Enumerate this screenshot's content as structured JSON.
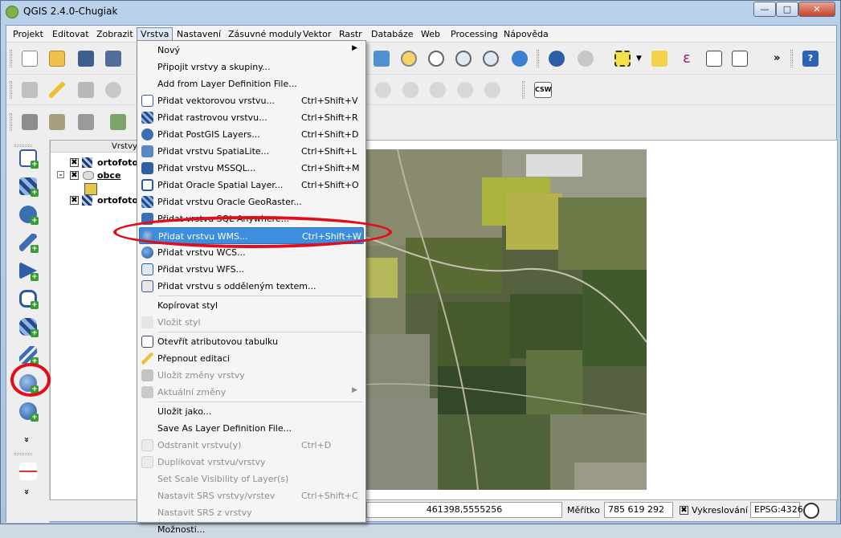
{
  "window": {
    "title": "QGIS 2.4.0-Chugiak",
    "minimize_glyph": "—",
    "maximize_glyph": "□",
    "close_glyph": "✕"
  },
  "menubar": {
    "items": [
      "Projekt",
      "Editovat",
      "Zobrazit",
      "Vrstva",
      "Nastavení",
      "Zásuvné moduly",
      "Vektor",
      "Rastr",
      "Databáze",
      "Web",
      "Processing",
      "Nápověda"
    ],
    "active": "Vrstva"
  },
  "layers_panel": {
    "title": "Vrstvy",
    "layers": [
      {
        "name": "ortofoto",
        "checked": true
      },
      {
        "name": "obce",
        "checked": true
      },
      {
        "name": "ortofoto",
        "checked": true
      }
    ]
  },
  "layer_menu": {
    "items": [
      {
        "label": "Nový",
        "shortcut": "",
        "submenu": true,
        "enabled": true,
        "icon": "none"
      },
      {
        "label": "Připojit vrstvy a skupiny...",
        "shortcut": "",
        "enabled": true,
        "icon": "none"
      },
      {
        "label": "Add from Layer Definition File...",
        "shortcut": "",
        "enabled": true,
        "icon": "none"
      },
      {
        "label": "Přidat vektorovou vrstvu...",
        "shortcut": "Ctrl+Shift+V",
        "enabled": true,
        "icon": "vector-layer-icon"
      },
      {
        "label": "Přidat rastrovou vrstvu...",
        "shortcut": "Ctrl+Shift+R",
        "enabled": true,
        "icon": "raster-layer-icon"
      },
      {
        "label": "Přidat PostGIS Layers...",
        "shortcut": "Ctrl+Shift+D",
        "enabled": true,
        "icon": "postgis-icon"
      },
      {
        "label": "Přidat vrstvu SpatiaLite...",
        "shortcut": "Ctrl+Shift+L",
        "enabled": true,
        "icon": "spatialite-icon"
      },
      {
        "label": "Přidat vrstvu MSSQL...",
        "shortcut": "Ctrl+Shift+M",
        "enabled": true,
        "icon": "mssql-icon"
      },
      {
        "label": "Přidat Oracle Spatial Layer...",
        "shortcut": "Ctrl+Shift+O",
        "enabled": true,
        "icon": "oracle-icon"
      },
      {
        "label": "Přidat vrstvu Oracle GeoRaster...",
        "shortcut": "",
        "enabled": true,
        "icon": "georaster-icon"
      },
      {
        "label": "Přidat vrstvu SQL Anywhere...",
        "shortcut": "",
        "enabled": true,
        "icon": "sqlanywhere-icon"
      },
      {
        "label": "Přidat vrstvu WMS...",
        "shortcut": "Ctrl+Shift+W",
        "enabled": true,
        "icon": "wms-icon",
        "highlighted": true
      },
      {
        "label": "Přidat vrstvu WCS...",
        "shortcut": "",
        "enabled": true,
        "icon": "wcs-icon"
      },
      {
        "label": "Přidat vrstvu WFS...",
        "shortcut": "",
        "enabled": true,
        "icon": "wfs-icon"
      },
      {
        "label": "Přidat vrstvu s odděleným textem...",
        "shortcut": "",
        "enabled": true,
        "icon": "delimited-text-icon"
      },
      {
        "label": "Kopírovat styl",
        "shortcut": "",
        "enabled": true,
        "icon": "none"
      },
      {
        "label": "Vložit styl",
        "shortcut": "",
        "enabled": false,
        "icon": "paste-style-icon"
      },
      {
        "label": "Otevřít atributovou tabulku",
        "shortcut": "",
        "enabled": true,
        "icon": "attribute-table-icon"
      },
      {
        "label": "Přepnout editaci",
        "shortcut": "",
        "enabled": true,
        "icon": "pencil-icon"
      },
      {
        "label": "Uložit změny vrstvy",
        "shortcut": "",
        "enabled": false,
        "icon": "save-edits-icon"
      },
      {
        "label": "Aktuální změny",
        "shortcut": "",
        "submenu": true,
        "enabled": false,
        "icon": "current-edits-icon"
      },
      {
        "label": "Uložit jako...",
        "shortcut": "",
        "enabled": true,
        "icon": "none"
      },
      {
        "label": "Save As Layer Definition File...",
        "shortcut": "",
        "enabled": true,
        "icon": "none"
      },
      {
        "label": "Odstranit vrstvu(y)",
        "shortcut": "Ctrl+D",
        "enabled": false,
        "icon": "remove-layer-icon"
      },
      {
        "label": "Duplikovat vrstvu/vrstvy",
        "shortcut": "",
        "enabled": false,
        "icon": "duplicate-layer-icon"
      },
      {
        "label": "Set Scale Visibility of Layer(s)",
        "shortcut": "",
        "enabled": false,
        "icon": "none"
      },
      {
        "label": "Nastavit SRS vrstvy/vrstev",
        "shortcut": "Ctrl+Shift+C",
        "enabled": false,
        "icon": "none"
      },
      {
        "label": "Nastavit SRS z vrstvy",
        "shortcut": "",
        "enabled": false,
        "icon": "none"
      },
      {
        "label": "Možnosti...",
        "shortcut": "",
        "enabled": true,
        "icon": "none"
      }
    ]
  },
  "statusbar": {
    "coordinates": "461398,5555256",
    "scale_label": "Měřítko",
    "scale_value": "785 619 292",
    "render_label": "Vykreslování",
    "render_checked": true,
    "crs": "EPSG:4326"
  },
  "toolbars": {
    "chevron": "»",
    "csw_label": "CSW",
    "help_glyph": "?",
    "epsilon_glyph": "ε"
  },
  "left_toolbar": {
    "more_glyph": "»",
    "items": [
      "add-vector-layer-icon",
      "add-raster-layer-icon",
      "add-postgis-layer-icon",
      "add-spatialite-layer-icon",
      "add-mssql-layer-icon",
      "add-oracle-layer-icon",
      "add-georaster-layer-icon",
      "add-sqlanywhere-layer-icon",
      "add-wms-layer-icon",
      "add-wcs-layer-icon"
    ]
  },
  "colors": {
    "menu_highlight": "#3c8fdf",
    "annotation_red": "#e00d1a",
    "plus_badge": "#3a9a33"
  }
}
